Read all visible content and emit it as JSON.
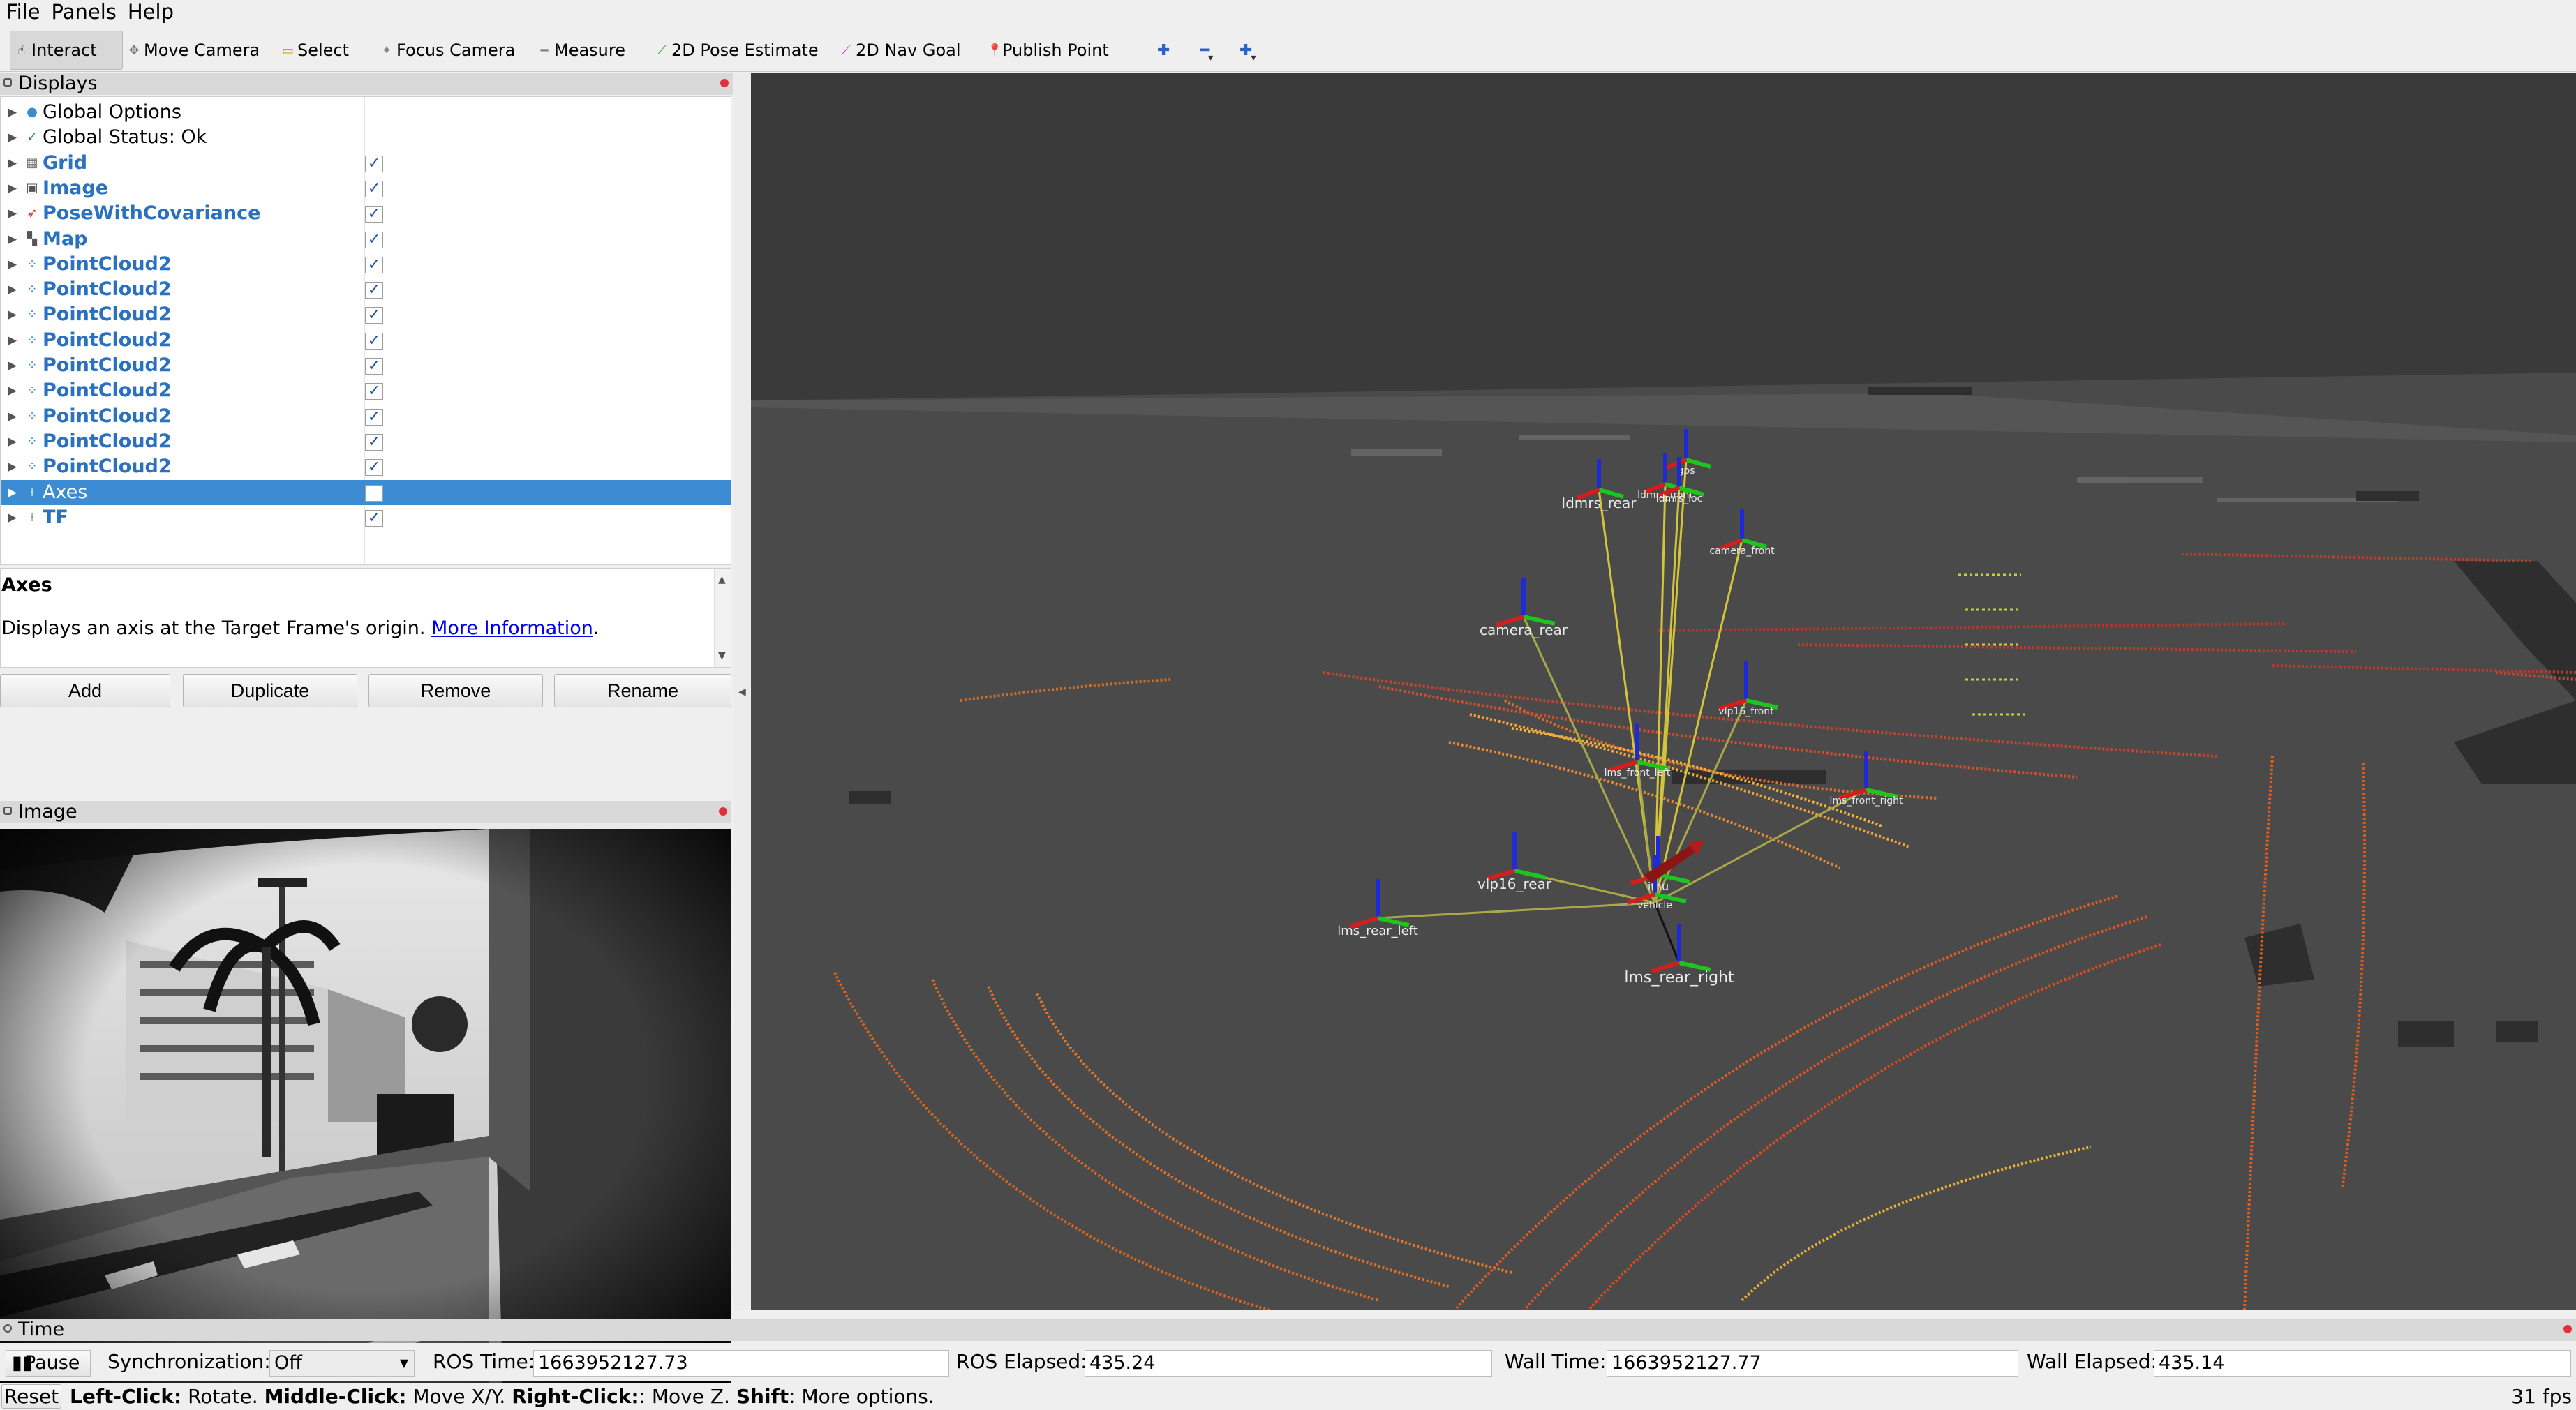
{
  "menu": [
    "File",
    "Panels",
    "Help"
  ],
  "toolbar": {
    "tools": [
      {
        "label": "Interact",
        "icon": "hand-icon"
      },
      {
        "label": "Move Camera",
        "icon": "move-camera-icon"
      },
      {
        "label": "Select",
        "icon": "select-icon"
      },
      {
        "label": "Focus Camera",
        "icon": "focus-camera-icon"
      },
      {
        "label": "Measure",
        "icon": "measure-icon"
      },
      {
        "label": "2D Pose Estimate",
        "icon": "pose-estimate-icon"
      },
      {
        "label": "2D Nav Goal",
        "icon": "nav-goal-icon"
      },
      {
        "label": "Publish Point",
        "icon": "publish-point-icon"
      }
    ],
    "extra_icons": [
      "add-tool-icon",
      "remove-tool-icon",
      "tool-options-icon"
    ]
  },
  "displays": {
    "title": "Displays",
    "items": [
      {
        "label": "Global Options",
        "checked": null,
        "bold": false,
        "icon": "globe-icon"
      },
      {
        "label": "Global Status: Ok",
        "checked": null,
        "bold": false,
        "icon": "checkmark-icon"
      },
      {
        "label": "Grid",
        "checked": true,
        "bold": true,
        "icon": "grid-icon"
      },
      {
        "label": "Image",
        "checked": true,
        "bold": true,
        "icon": "image-icon"
      },
      {
        "label": "PoseWithCovariance",
        "checked": true,
        "bold": true,
        "icon": "pose-arrow-icon"
      },
      {
        "label": "Map",
        "checked": true,
        "bold": true,
        "icon": "map-icon"
      },
      {
        "label": "PointCloud2",
        "checked": true,
        "bold": true,
        "icon": "pointcloud-icon"
      },
      {
        "label": "PointCloud2",
        "checked": true,
        "bold": true,
        "icon": "pointcloud-icon"
      },
      {
        "label": "PointCloud2",
        "checked": true,
        "bold": true,
        "icon": "pointcloud-icon"
      },
      {
        "label": "PointCloud2",
        "checked": true,
        "bold": true,
        "icon": "pointcloud-icon"
      },
      {
        "label": "PointCloud2",
        "checked": true,
        "bold": true,
        "icon": "pointcloud-icon"
      },
      {
        "label": "PointCloud2",
        "checked": true,
        "bold": true,
        "icon": "pointcloud-icon"
      },
      {
        "label": "PointCloud2",
        "checked": true,
        "bold": true,
        "icon": "pointcloud-icon"
      },
      {
        "label": "PointCloud2",
        "checked": true,
        "bold": true,
        "icon": "pointcloud-icon"
      },
      {
        "label": "PointCloud2",
        "checked": true,
        "bold": true,
        "icon": "pointcloud-icon"
      },
      {
        "label": "Axes",
        "checked": false,
        "bold": false,
        "selected": true,
        "icon": "axes-icon"
      },
      {
        "label": "TF",
        "checked": true,
        "bold": true,
        "icon": "tf-icon"
      }
    ]
  },
  "description": {
    "heading": "Axes",
    "text": "Displays an axis at the Target Frame's origin. ",
    "link": "More Information",
    "suffix": "."
  },
  "buttons": [
    "Add",
    "Duplicate",
    "Remove",
    "Rename"
  ],
  "image_panel": {
    "title": "Image"
  },
  "frames": [
    "gps",
    "ldmrs_front",
    "ldmrs_loc",
    "ldmrs_rear",
    "camera_front",
    "camera_rear",
    "vlp16_front",
    "lms_front_left",
    "lms_front_right",
    "vlp16_rear",
    "imu",
    "vehicle",
    "lms_rear_left",
    "lms_rear_right"
  ],
  "time": {
    "title": "Time",
    "pause_label": "Pause",
    "sync_label": "Synchronization:",
    "sync_value": "Off",
    "ros_time_label": "ROS Time:",
    "ros_time": "1663952127.73",
    "ros_elapsed_label": "ROS Elapsed:",
    "ros_elapsed": "435.24",
    "wall_time_label": "Wall Time:",
    "wall_time": "1663952127.77",
    "wall_elapsed_label": "Wall Elapsed:",
    "wall_elapsed": "435.14"
  },
  "status": {
    "reset": "Reset",
    "left_click": "Left-Click:",
    "left_click_desc": " Rotate. ",
    "middle_click": "Middle-Click:",
    "middle_click_desc": " Move X/Y. ",
    "right_click": "Right-Click:",
    "right_click_desc": ": Move Z. ",
    "shift": "Shift",
    "shift_desc": ": More options.",
    "fps": "31 fps"
  },
  "colors": {
    "selection": "#3b8cd2",
    "display_label": "#2a71c0",
    "close_dot": "#e0313b",
    "viewport_bg": "#474747"
  }
}
